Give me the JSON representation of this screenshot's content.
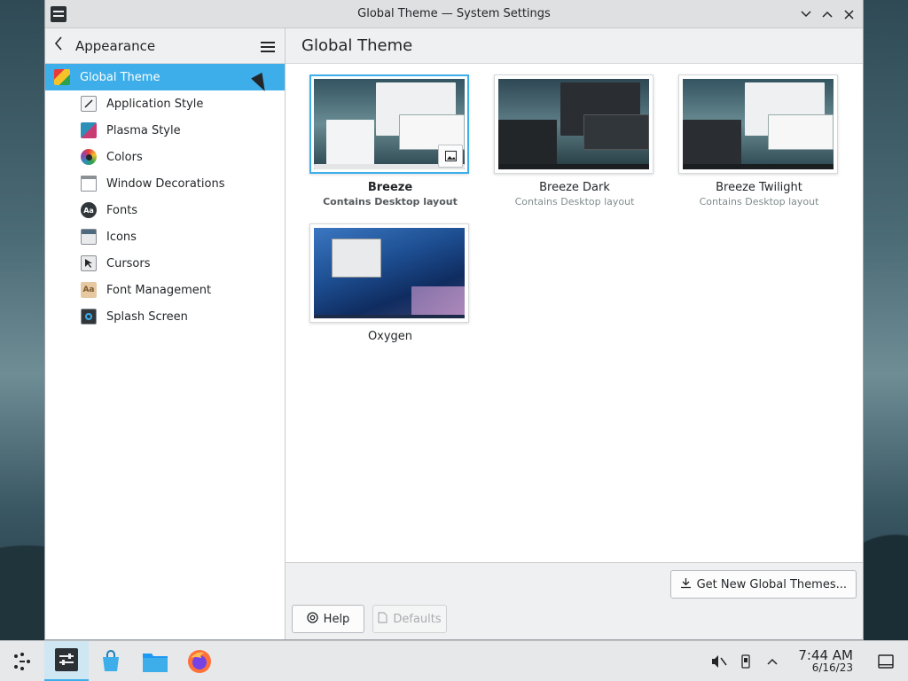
{
  "window": {
    "title": "Global Theme — System Settings"
  },
  "sidebar": {
    "back_label": "Appearance",
    "items": [
      {
        "label": "Global Theme",
        "icon": "global-theme-icon",
        "active": true
      },
      {
        "label": "Application Style",
        "icon": "application-style-icon"
      },
      {
        "label": "Plasma Style",
        "icon": "plasma-style-icon"
      },
      {
        "label": "Colors",
        "icon": "colors-icon"
      },
      {
        "label": "Window Decorations",
        "icon": "window-decorations-icon"
      },
      {
        "label": "Fonts",
        "icon": "fonts-icon"
      },
      {
        "label": "Icons",
        "icon": "icons-icon"
      },
      {
        "label": "Cursors",
        "icon": "cursors-icon"
      },
      {
        "label": "Font Management",
        "icon": "font-management-icon"
      },
      {
        "label": "Splash Screen",
        "icon": "splash-screen-icon"
      }
    ]
  },
  "main": {
    "title": "Global Theme",
    "themes": [
      {
        "name": "Breeze",
        "subtitle": "Contains Desktop layout",
        "selected": true
      },
      {
        "name": "Breeze Dark",
        "subtitle": "Contains Desktop layout"
      },
      {
        "name": "Breeze Twilight",
        "subtitle": "Contains Desktop layout"
      },
      {
        "name": "Oxygen",
        "subtitle": ""
      }
    ],
    "get_new_label": "Get New Global Themes...",
    "help_label": "Help",
    "defaults_label": "Defaults"
  },
  "taskbar": {
    "apps": [
      "application-launcher-icon",
      "system-settings-icon",
      "discover-icon",
      "dolphin-icon",
      "firefox-icon"
    ],
    "time": "7:44 AM",
    "date": "6/16/23"
  },
  "colors": {
    "accent": "#3daee9"
  }
}
